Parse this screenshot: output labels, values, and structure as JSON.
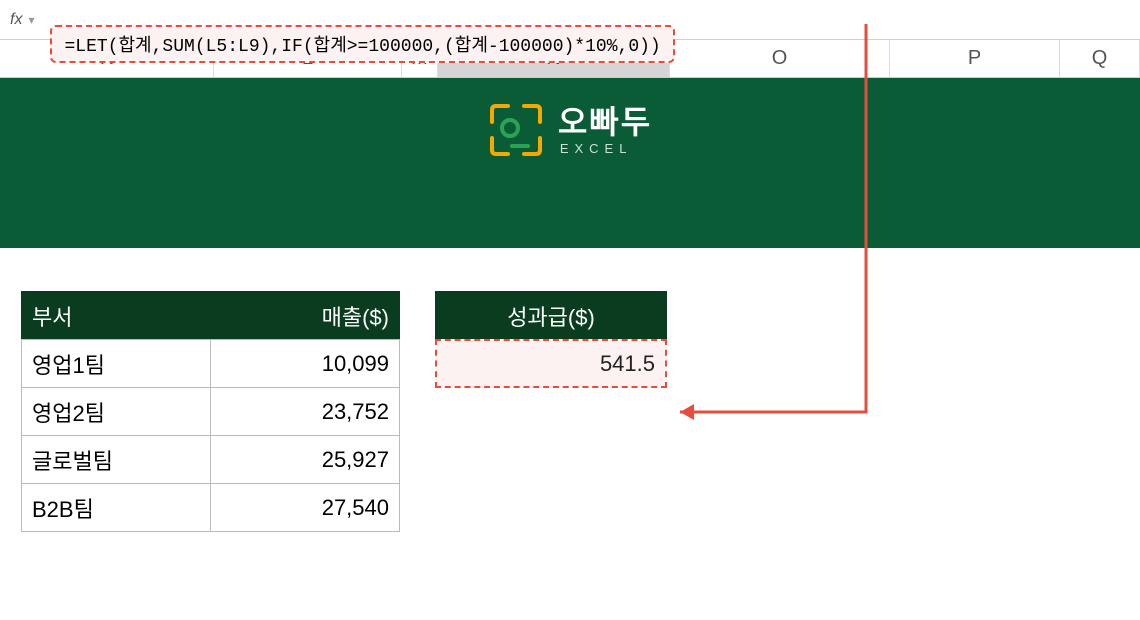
{
  "formula_bar": {
    "fx": "fx",
    "formula": "=LET(합계,SUM(L5:L9),IF(합계>=100000,(합계-100000)*10%,0))"
  },
  "columns": {
    "K": "K",
    "L": "L",
    "M": "M",
    "N": "N",
    "O": "O",
    "P": "P",
    "Q": "Q"
  },
  "banner": {
    "brand_kr": "오빠두",
    "brand_en": "EXCEL"
  },
  "table": {
    "headers": {
      "dept": "부서",
      "sales": "매출($)",
      "bonus": "성과급($)"
    },
    "rows": [
      {
        "dept": "영업1팀",
        "sales": "10,099"
      },
      {
        "dept": "영업2팀",
        "sales": "23,752"
      },
      {
        "dept": "글로벌팀",
        "sales": "25,927"
      },
      {
        "dept": "B2B팀",
        "sales": "27,540"
      }
    ],
    "bonus_value": "541.5"
  },
  "chart_data": {
    "type": "table",
    "title": "",
    "columns": [
      "부서",
      "매출($)"
    ],
    "rows": [
      [
        "영업1팀",
        10099
      ],
      [
        "영업2팀",
        23752
      ],
      [
        "글로벌팀",
        25927
      ],
      [
        "B2B팀",
        27540
      ]
    ],
    "derived": {
      "성과급($)": 541.5
    }
  }
}
